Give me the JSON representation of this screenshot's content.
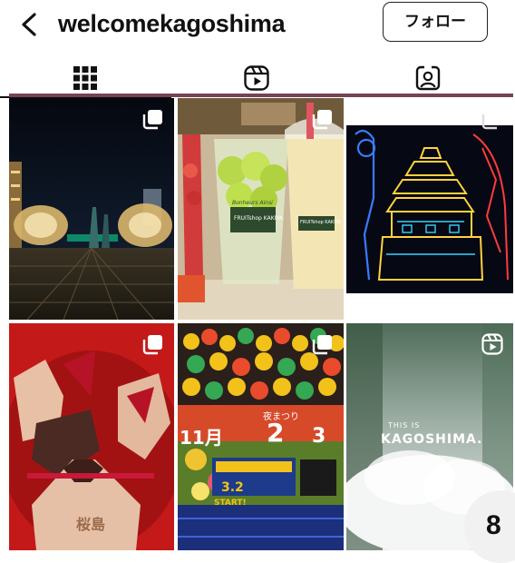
{
  "header": {
    "username": "welcomekagoshima",
    "follow_label": "フォロー"
  },
  "tabs": [
    {
      "name": "posts",
      "icon": "grid-icon",
      "active": true
    },
    {
      "name": "reels",
      "icon": "reels-icon",
      "active": false
    },
    {
      "name": "tagged",
      "icon": "tagged-user-icon",
      "active": false
    }
  ],
  "posts": [
    {
      "type": "carousel",
      "icon": "carousel-icon"
    },
    {
      "type": "carousel",
      "icon": "carousel-icon",
      "texts": {
        "shop1": "FRUITshop KAKIYA",
        "shop2": "FRUITshop KAKIYA",
        "brand": "Bonheurs Ainsi"
      }
    },
    {
      "type": "carousel",
      "icon": "carousel-icon"
    },
    {
      "type": "carousel",
      "icon": "carousel-icon",
      "texts": {
        "label": "桜島"
      }
    },
    {
      "type": "carousel",
      "icon": "carousel-icon",
      "texts": {
        "month": "11月",
        "day_a": "2",
        "day_b": "3",
        "banner": "3.2",
        "start": "START!",
        "event": "夜まつり"
      }
    },
    {
      "type": "reel",
      "icon": "reel-icon",
      "texts": {
        "headline": "THIS IS",
        "name": "KAGOSHIMA."
      }
    }
  ],
  "page_indicator": "8",
  "colors": {
    "accent": "#111111",
    "bg": "#ffffff"
  }
}
